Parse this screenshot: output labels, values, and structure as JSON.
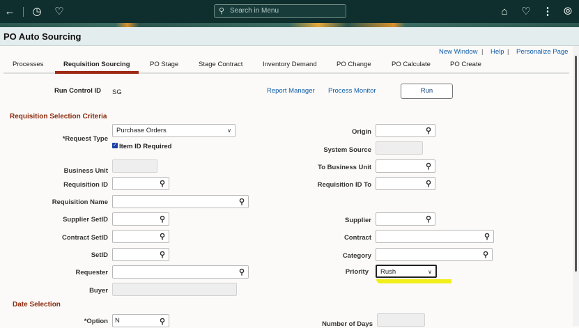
{
  "topbar": {
    "search_placeholder": "Search in Menu"
  },
  "page_title": "PO Auto Sourcing",
  "links": {
    "new_window": "New Window",
    "help": "Help",
    "personalize": "Personalize Page",
    "sep": "|"
  },
  "tabs": [
    "Processes",
    "Requisition Sourcing",
    "PO Stage",
    "Stage Contract",
    "Inventory Demand",
    "PO Change",
    "PO Calculate",
    "PO Create"
  ],
  "run": {
    "label": "Run Control ID",
    "value": "SG",
    "report_manager": "Report Manager",
    "process_monitor": "Process Monitor",
    "run_button": "Run"
  },
  "section1": "Requisition Selection Criteria",
  "section2": "Date Selection",
  "fields": {
    "request_type": {
      "label": "*Request Type",
      "value": "Purchase Orders"
    },
    "item_id_required": {
      "label": "Item ID Required",
      "checked": true
    },
    "business_unit": "Business Unit",
    "requisition_id": "Requisition ID",
    "requisition_name": "Requisition Name",
    "supplier_setid": "Supplier SetID",
    "contract_setid": "Contract SetID",
    "setid": "SetID",
    "requester": "Requester",
    "buyer": "Buyer",
    "origin": "Origin",
    "system_source": "System Source",
    "to_business_unit": "To Business Unit",
    "requisition_id_to": "Requisition ID To",
    "supplier": "Supplier",
    "contract": "Contract",
    "category": "Category",
    "priority": {
      "label": "Priority",
      "value": "Rush"
    },
    "option": {
      "label": "*Option",
      "value": "N"
    },
    "number_of_days": "Number of Days"
  },
  "colors": {
    "header": "#0e2f2d",
    "accent": "#9e2a15",
    "link": "#0f5ca8",
    "highlight": "#f2ee1a"
  }
}
